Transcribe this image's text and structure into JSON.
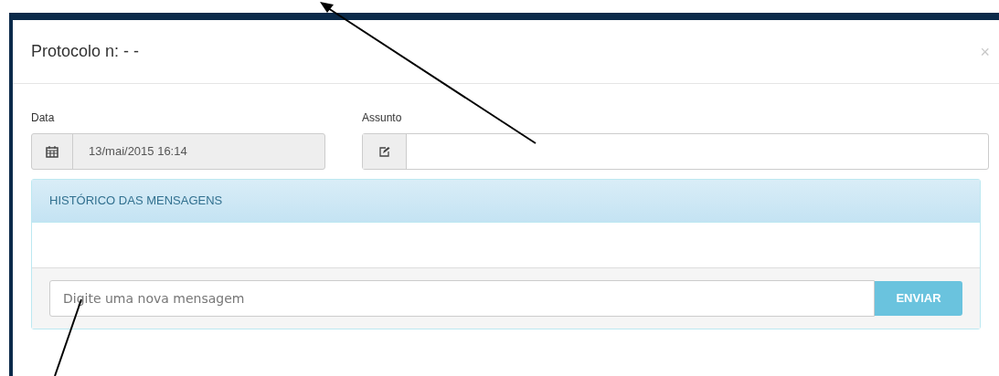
{
  "modal": {
    "title": "Protocolo n: - -",
    "close": "×"
  },
  "form": {
    "date": {
      "label": "Data",
      "value": "13/mai/2015 16:14"
    },
    "subject": {
      "label": "Assunto"
    }
  },
  "history": {
    "title": "HISTÓRICO DAS MENSAGENS"
  },
  "message": {
    "placeholder": "Digite uma nova mensagem",
    "button": "ENVIAR"
  }
}
